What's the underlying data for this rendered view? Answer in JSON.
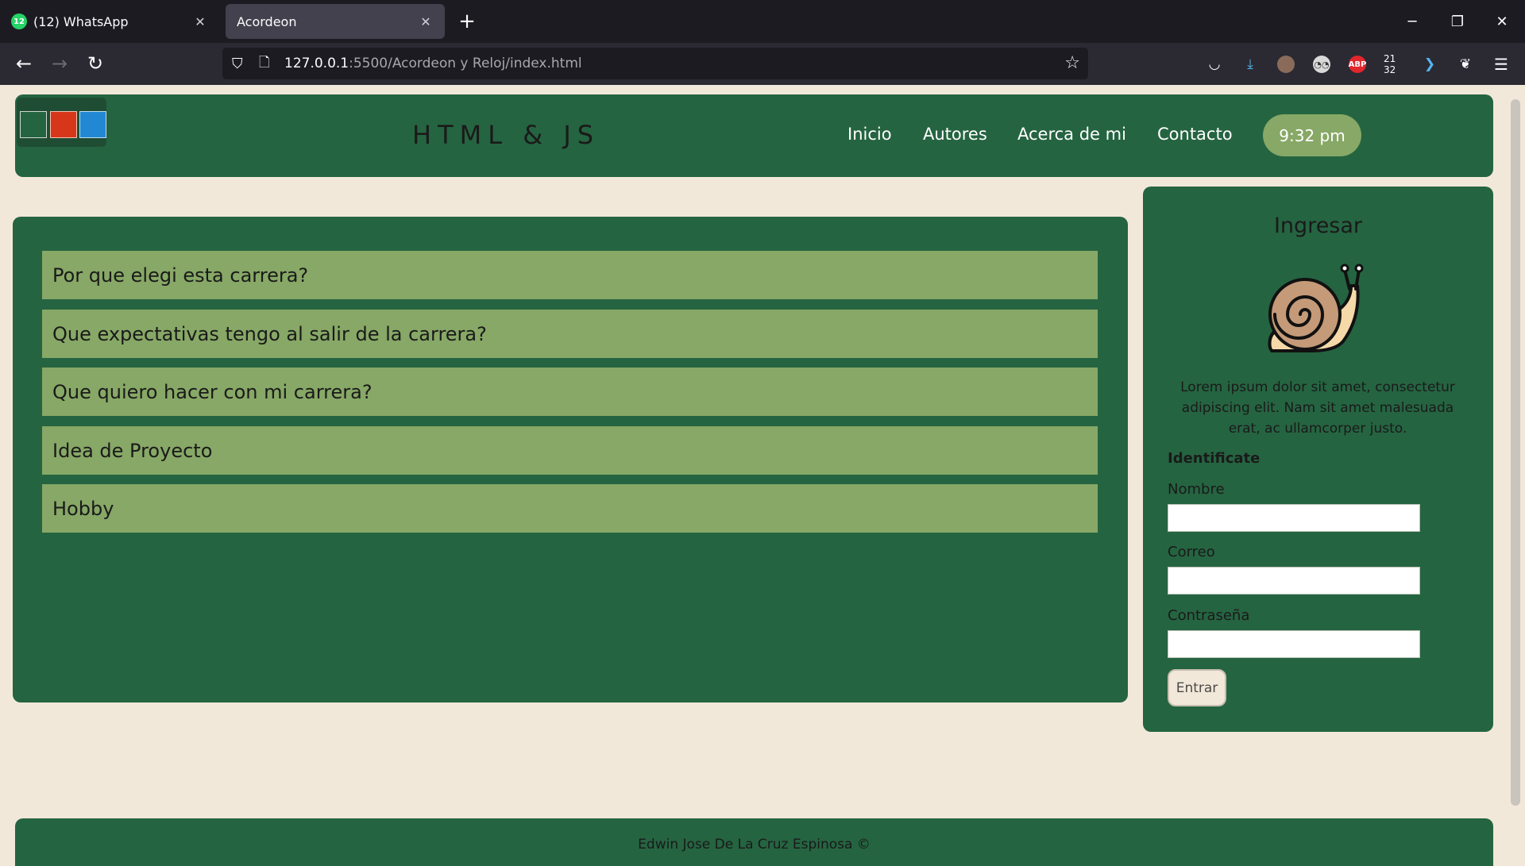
{
  "browser": {
    "tabs": [
      {
        "badge": "12",
        "title": "(12) WhatsApp"
      },
      {
        "title": "Acordeon"
      }
    ],
    "url_host": "127.0.0.1",
    "url_path": ":5500/Acordeon y Reloj/index.html",
    "ext_time": "21 32",
    "ext_abp": "ABP"
  },
  "header": {
    "theme_colors": [
      "#256441",
      "#d6371a",
      "#2388d3"
    ],
    "brand": "HTML & JS",
    "nav": [
      "Inicio",
      "Autores",
      "Acerca de mi",
      "Contacto"
    ],
    "clock": "9:32 pm"
  },
  "accordion": {
    "items": [
      "Por que elegi esta carrera?",
      "Que expectativas tengo al salir de la carrera?",
      "Que quiero hacer con mi carrera?",
      "Idea de Proyecto",
      "Hobby"
    ]
  },
  "sidebar": {
    "title": "Ingresar",
    "description": "Lorem ipsum dolor sit amet, consectetur adipiscing elit. Nam sit amet malesuada erat, ac ullamcorper justo.",
    "form_heading": "Identificate",
    "fields": [
      {
        "label": "Nombre",
        "value": ""
      },
      {
        "label": "Correo",
        "value": ""
      },
      {
        "label": "Contraseña",
        "value": ""
      }
    ],
    "submit": "Entrar"
  },
  "footer": {
    "text": "Edwin Jose De La Cruz Espinosa ©"
  },
  "colors": {
    "page_bg": "#f2e8d9",
    "panel_green": "#256441",
    "accent_green": "#87a866"
  }
}
